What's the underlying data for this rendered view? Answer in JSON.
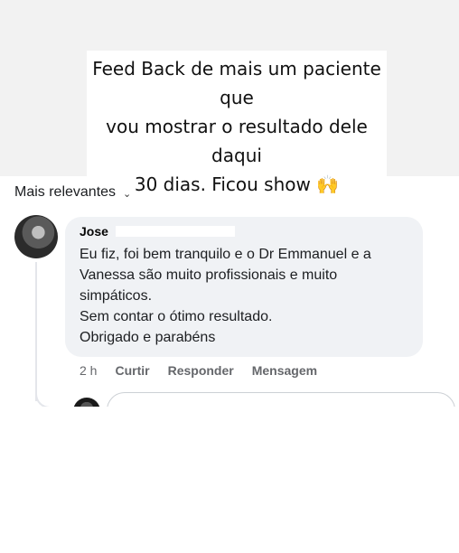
{
  "story": {
    "caption_lines": [
      "Feed Back de mais um paciente que",
      "vou mostrar o resultado dele daqui",
      "30 dias. Ficou show 🙌"
    ]
  },
  "comments": {
    "sort_label": "Mais relevantes",
    "sort_icon": "chevron-down-icon",
    "items": [
      {
        "author": "Jose",
        "text_lines": [
          "Eu fiz, foi bem tranquilo e o Dr Emmanuel e a",
          "Vanessa são muito profissionais e muito",
          "simpáticos.",
          "Sem contar o ótimo resultado.",
          "Obrigado e parabéns"
        ],
        "time": "2 h",
        "actions": [
          "Curtir",
          "Responder",
          "Mensagem"
        ]
      }
    ]
  },
  "colors": {
    "bubble": "#f0f2f5",
    "meta_text": "#65676b",
    "story_background": "#f2f2f2"
  }
}
